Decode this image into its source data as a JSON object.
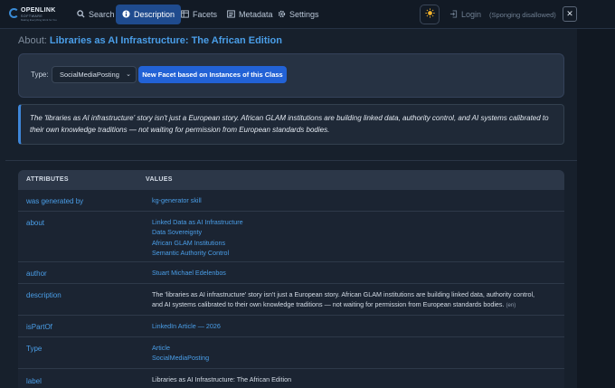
{
  "nav": {
    "logo_text": "OPENLINK",
    "logo_sub": "SOFTWARE",
    "logo_tag": "Making Everything Work for You",
    "items": [
      {
        "label": "Search",
        "icon": "search-icon"
      },
      {
        "label": "Description",
        "icon": "info-icon"
      },
      {
        "label": "Facets",
        "icon": "facets-icon"
      },
      {
        "label": "Metadata",
        "icon": "metadata-icon"
      },
      {
        "label": "Settings",
        "icon": "gear-icon"
      }
    ],
    "active": "Description",
    "theme_icon": "sun-icon",
    "login_label": "Login",
    "sponging_label": "(Sponging disallowed)",
    "close_icon": "close-icon"
  },
  "about": {
    "label": "About:",
    "title": "Libraries as AI Infrastructure: The African Edition"
  },
  "type_filter": {
    "label": "Type:",
    "selected": "SocialMediaPosting",
    "button_label": "New Facet based on Instances of this Class"
  },
  "quote": "The 'libraries as AI infrastructure' story isn't just a European story. African GLAM institutions are building linked data, authority control, and AI systems calibrated to their own knowledge traditions — not waiting for permission from European standards bodies.",
  "table": {
    "headers": [
      "ATTRIBUTES",
      "VALUES"
    ],
    "rows": [
      {
        "attribute": "was generated by",
        "values": [
          {
            "text": "kg-generator skill",
            "link": true
          }
        ]
      },
      {
        "attribute": "about",
        "values": [
          {
            "text": "Linked Data as AI Infrastructure",
            "link": true
          },
          {
            "text": "Data Sovereignty",
            "link": true
          },
          {
            "text": "African GLAM Institutions",
            "link": true
          },
          {
            "text": "Semantic Authority Control",
            "link": true
          }
        ]
      },
      {
        "attribute": "author",
        "values": [
          {
            "text": "Stuart Michael Edelenbos",
            "link": true
          }
        ]
      },
      {
        "attribute": "description",
        "values": [
          {
            "text": "The 'libraries as AI infrastructure' story isn't just a European story. African GLAM institutions are building linked data, authority control,",
            "link": false
          },
          {
            "text": "and AI systems calibrated to their own knowledge traditions — not waiting for permission from European standards bodies.",
            "link": false,
            "lang": "(en)"
          }
        ]
      },
      {
        "attribute": "isPartOf",
        "values": [
          {
            "text": "LinkedIn Article — 2026",
            "link": true
          }
        ]
      },
      {
        "attribute": "Type",
        "values": [
          {
            "text": "Article",
            "link": true
          },
          {
            "text": "SocialMediaPosting",
            "link": true
          }
        ]
      },
      {
        "attribute": "label",
        "values": [
          {
            "text": "Libraries as AI Infrastructure: The African Edition",
            "link": false
          }
        ]
      }
    ]
  },
  "colors": {
    "accent": "#4a9ee8",
    "active_tab": "#1f4b8e",
    "button": "#2262d6",
    "background": "#17202c"
  }
}
